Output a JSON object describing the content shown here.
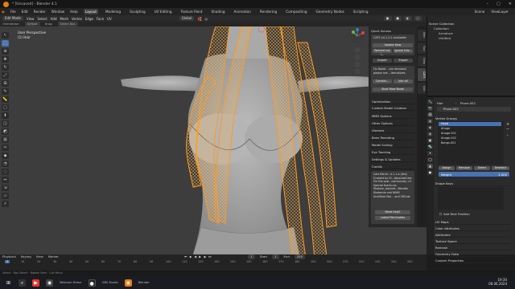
{
  "window": {
    "title": "* [Unsaved] - Blender 4.1"
  },
  "menu": {
    "items": [
      "File",
      "Edit",
      "Render",
      "Window",
      "Help"
    ],
    "workspaces": [
      "Layout",
      "Modeling",
      "Sculpting",
      "UV Editing",
      "Texture Paint",
      "Shading",
      "Animation",
      "Rendering",
      "Compositing",
      "Geometry Nodes",
      "Scripting"
    ],
    "scene_label": "Scene",
    "view_layer_label": "ViewLayer"
  },
  "viewport_header": {
    "mode": "Edit Mode",
    "view": "View",
    "select": "Select",
    "add": "Add",
    "mesh": "Mesh",
    "vertex": "Vertex",
    "edge": "Edge",
    "face": "Face",
    "uv": "UV",
    "orientation_label": "Orientation:",
    "orientation_value": "Default",
    "drag_label": "Drag:",
    "drag_value": "Select Box",
    "transform": "Global"
  },
  "viewport": {
    "view_name": "User Perspective",
    "object_name": "(1) Hair"
  },
  "npanel": {
    "section_quick": "Quick Access",
    "cats_version": "CATS v4.1.2.2 available!",
    "update_now": "Update Now",
    "remind_later": "Remind me l...",
    "ignore_this": "Ignore this...",
    "import_label": "Import",
    "export_label": "Export",
    "deprecation_line1": "Fix Model ...om removed.",
    "deprecation_line2": "please see ...lternatives.",
    "combine_label": "Combin...",
    "join_all": "Join all",
    "start_pose_mode": "Start Pose Mode",
    "sections": [
      "Optimization",
      "Custom Model Creation",
      "MMD Options",
      "Other Options",
      "Visemes",
      "Bone Parenting",
      "Model Scaling",
      "Eye Tracking",
      "Settings & Updates",
      "Credits"
    ],
    "credits_title": "Cats Blend...4.1.1-a (dev)",
    "credits_lines": [
      "Created by Hi...AbsoluteCats",
      "For the posi...community <3",
      "",
      "Special thanks to:",
      "Shotaro, Jeannet...Blender",
      "Shoberdo and NIKKI",
      "",
      "Unofficial Mai... and VRChat"
    ],
    "need_help": "Need help?",
    "latest_patchnotes": "Latest Patchnotes"
  },
  "npanel_tabs": [
    "Item",
    "Tool",
    "View",
    "CATS",
    "Edit"
  ],
  "outliner": {
    "root": "Scene Collection",
    "items": [
      "Collection",
      "Armature",
      "Untitled"
    ]
  },
  "properties": {
    "object": "Hair",
    "mesh_name": "Plane.002",
    "section_vertex_groups": "Vertex Groups",
    "vertex_groups": [
      "Head",
      "Ahoge",
      "Ahoge.001",
      "Ahoge.002",
      "Bangs.001"
    ],
    "assign": "Assign",
    "remove": "Remove",
    "select": "Select",
    "deselect": "Deselect",
    "weight_label": "Weight",
    "weight_value": "1.000",
    "section_shape_keys": "Shape Keys",
    "add_rest_position": "Add Rest Position",
    "sections": [
      "UV Maps",
      "Color Attributes",
      "Attributes",
      "Texture Space",
      "Remesh",
      "Geometry Data",
      "Custom Properties"
    ]
  },
  "timeline": {
    "playback": "Playback",
    "keying": "Keying",
    "view": "View",
    "marker": "Marker",
    "current_frame": "1",
    "start_label": "Start",
    "start": "1",
    "end_label": "End",
    "end": "250",
    "frame_ticks": [
      "1",
      "10",
      "20",
      "30",
      "40",
      "50",
      "60",
      "70",
      "80",
      "90",
      "100",
      "110",
      "120",
      "130",
      "140",
      "150",
      "160",
      "170",
      "180",
      "190",
      "200",
      "210",
      "220",
      "230",
      "240",
      "250"
    ]
  },
  "statusbar": {
    "text": "Select  ·  Box Select  ·  Rotate View  ·  Call Menu"
  },
  "taskbar": {
    "items": [
      "Webcam Hebur",
      "OBS Studio",
      "Blender"
    ],
    "time": "19:30",
    "date": "08.06.2024"
  },
  "colors": {
    "accent": "#4772b3",
    "hair": "#e8861c",
    "body": "#a8a8a8",
    "viewport_bg": "#3d3d3d"
  }
}
